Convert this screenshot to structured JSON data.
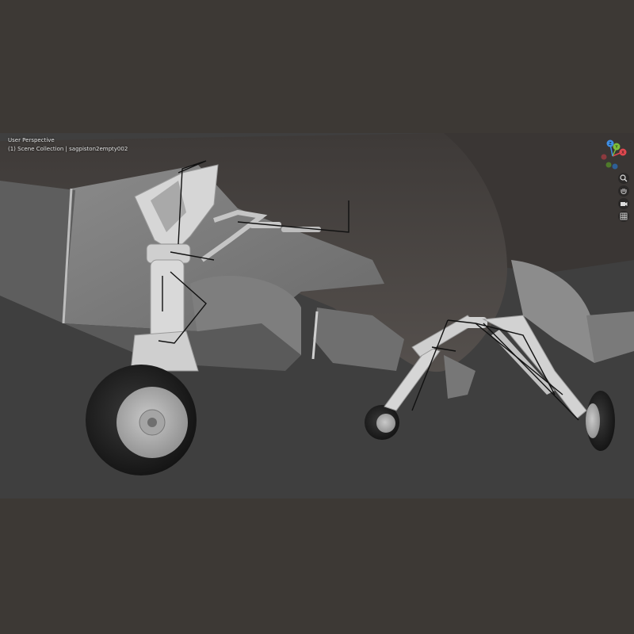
{
  "viewport": {
    "view_name": "User Perspective",
    "collection_info": "(1) Scene Collection | sagpiston2empty002"
  },
  "gizmo": {
    "axis_x_label": "X",
    "axis_y_label": "Y",
    "axis_z_label": "Z",
    "color_x": "#e0484f",
    "color_y": "#7fbf3a",
    "color_z": "#3f8fe6"
  },
  "nav_buttons": [
    {
      "icon": "zoom-icon"
    },
    {
      "icon": "hand-pan-icon"
    },
    {
      "icon": "camera-icon"
    },
    {
      "icon": "grid-icon"
    }
  ],
  "colors": {
    "page_background": "#3d3935",
    "viewport_background": "#3f3f3f",
    "model_light": "#d9d9d9",
    "model_dark": "#4a4644",
    "rig_lines": "#111111"
  }
}
